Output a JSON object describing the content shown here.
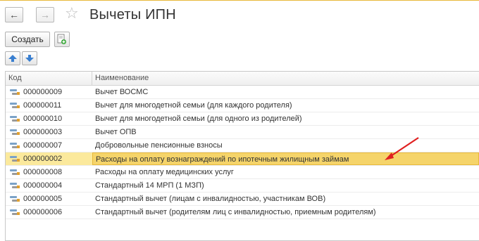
{
  "window": {
    "title": "Вычеты ИПН"
  },
  "nav": {
    "back_icon": "arrow-left",
    "forward_icon": "arrow-right",
    "favorite_icon": "star"
  },
  "toolbar": {
    "create_label": "Создать",
    "copy_icon": "copy-add-icon",
    "move_up_icon": "arrow-up",
    "move_down_icon": "arrow-down"
  },
  "table": {
    "columns": [
      "Код",
      "Наименование"
    ],
    "rows": [
      {
        "code": "000000009",
        "name": "Вычет ВОСМС"
      },
      {
        "code": "000000011",
        "name": "Вычет для многодетной семьи (для каждого родителя)"
      },
      {
        "code": "000000010",
        "name": "Вычет для многодетной семьи (для одного из родителей)"
      },
      {
        "code": "000000003",
        "name": "Вычет ОПВ"
      },
      {
        "code": "000000007",
        "name": "Добровольные пенсионные взносы"
      },
      {
        "code": "000000002",
        "name": "Расходы на оплату вознаграждений по ипотечным жилищным займам",
        "selected": true
      },
      {
        "code": "000000008",
        "name": "Расходы на оплату медицинских услуг"
      },
      {
        "code": "000000004",
        "name": "Стандартный 14 МРП (1 МЗП)"
      },
      {
        "code": "000000005",
        "name": "Стандартный вычет (лицам с инвалидностью, участникам ВОВ)"
      },
      {
        "code": "000000006",
        "name": "Стандартный вычет (родителям лиц с инвалидностью, приемным родителям)"
      }
    ]
  },
  "colors": {
    "selection": "#f5d46a",
    "annotation_arrow": "#e02020"
  }
}
